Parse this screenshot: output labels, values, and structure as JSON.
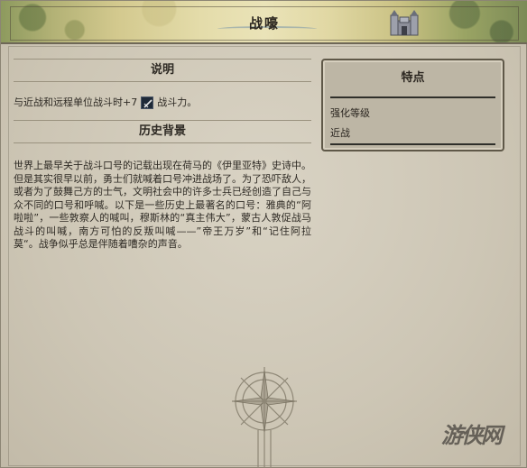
{
  "window": {
    "title": "战嚎"
  },
  "description": {
    "heading": "说明",
    "text_before": "与近战和远程单位战斗时+7",
    "text_after": "战斗力。",
    "icon": "combat-strength-icon"
  },
  "history": {
    "heading": "历史背景",
    "text": "世界上最早关于战斗口号的记载出现在荷马的《伊里亚特》史诗中。但是其实很早以前，勇士们就喊着口号冲进战场了。为了恐吓敌人，或者为了鼓舞己方的士气，文明社会中的许多士兵已经创造了自己与众不同的口号和呼喊。以下是一些历史上最著名的口号：雅典的“阿啦啦”，一些敦察人的喊叫，穆斯林的“真主伟大”，蒙古人敦促战马战斗的叫喊，南方可怕的反叛叫喊——”帝王万岁”和“记住阿拉莫“。战争似乎总是伴随着嘈杂的声音。"
  },
  "traits": {
    "heading": "特点",
    "items": [
      {
        "label": "强化等级"
      },
      {
        "label": "近战"
      }
    ]
  },
  "watermark": {
    "text": "游侠网"
  },
  "colors": {
    "background": "#cfc8b8",
    "text": "#2e2a24",
    "trait_rule": "#2f2f2a",
    "icon_bg": "#1f2a38"
  }
}
